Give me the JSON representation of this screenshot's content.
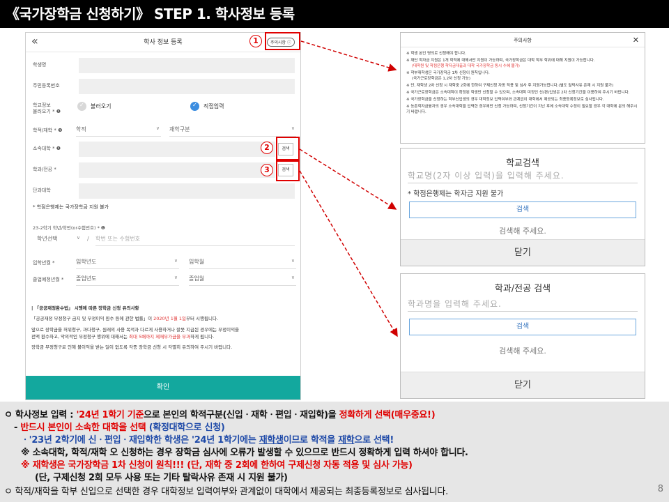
{
  "slide_title": "《국가장학금 신청하기》 STEP 1. 학사정보 등록",
  "form": {
    "back_icon": "«",
    "header_title": "학사 정보 등록",
    "notice_button": "주의사항 ⓘ",
    "student_name_label": "학생명",
    "resident_no_label": "주민등록번호",
    "school_info_label": "학교정보\n불러오기 * ❶",
    "radio_load": "불러오기",
    "radio_direct": "직접입력",
    "status_label": "학적/재학 * ❶",
    "status_select": "학적",
    "enroll_select": "재학구분",
    "university_label": "소속대학 * ❶",
    "major_label": "학과/전공 *",
    "college_label": "단과대학",
    "search_button": "검색",
    "no_credit_bank": "* 학점은행제는 국가장학금 지원 불가",
    "semester_label": "23-2학기 학년/학번(or수험번호) * ❶",
    "grade_select": "학년선택",
    "student_no_placeholder": "학번 또는 수험번호",
    "admission_label": "입학년월 *",
    "admission_year": "입학년도",
    "admission_month": "입학월",
    "graduation_label": "졸업예정년월 *",
    "graduation_year": "졸업년도",
    "graduation_month": "졸업월",
    "law_title": "| 「공공재정환수법」 시행에 따른 장학금 신청 유의사항",
    "law_line1a": "「공공재정 부정청구 금지 및 부정이익 환수 등에 관한 법률」이 ",
    "law_line1b": "2020년 1월 1일",
    "law_line1c": "부터 시행됩니다.",
    "law_line2": "앞으로 장학금을 허위청구, 과다청구, 원래의 사용 목적과 다르게 사용하거나 잘못 지급된 경우에는 부정이익을",
    "law_line3a": "전액 환수하고, 악의적인 부정청구 행위에 대해서는 ",
    "law_line3b": "최대 5배까지 제재부가금을 부과",
    "law_line3c": "하게 됩니다.",
    "law_line4": "장학금 부정청구로 인해 불이익을 받는 일이 없도록 각종 장학금 신청 시 각별히 유의하여 주시기 바랍니다.",
    "confirm_button": "확인"
  },
  "callouts": [
    "1",
    "2",
    "3"
  ],
  "notice_popup": {
    "title": "주의사항",
    "close": "✕",
    "items": [
      "※ 학생 본인 명의로 신청해야 합니다.",
      "※ 재단 학자금 지원은 1개 학적에 대해서만 지원이 가능하며, 국가장학금은 대학 학부 학위에 대해 지원이 가능합니다.",
      "(대학원 및 학점은행 학자금대출과 대학 국가장학금 동시 수혜 불가)",
      "※ 학부재학생은 국가장학금 1차 신청이 원칙입니다.",
      "(국가근로장학금은 1,2차 신청 가능)",
      "※ 단, 재학생 2차 신청 시 재학중 2회에 한하여 구제신청 자동 적용 및 심사 후 지원가능합니다.(별도 탈락사유 존재 시 지원 불가)",
      "※ 국가근로장학금은 소속대학이 확정된 학생만 신청할 수 있으며, 소속대학 미정인 신(편)입생은 2차 신청기간을 이용하여 주시기 바랍니다.",
      "※ 국가장학금을 신청하는 학부신입생의 경우 대학정보 입력여부와 관계없이 대학에서 제공되는 최종등록정보로 심사됩니다.",
      "※ 농촌학자금융자의 경우 소속대학을 입력한 경우에만 신청 가능하며, 신청기간이 지난 후에 소속대학 수정이 필요할 경우 각 대학에 문의 해주시기 바랍니다."
    ]
  },
  "school_popup": {
    "title": "학교검색",
    "placeholder": "학교명(2자 이상 입력)을 입력해 주세요.",
    "note": "* 학점은행제는 학자금 지원 불가",
    "search": "검색",
    "hint": "검색해 주세요.",
    "close": "닫기"
  },
  "major_popup": {
    "title": "학과/전공 검색",
    "placeholder": "학과명을 입력해 주세요.",
    "search": "검색",
    "hint": "검색해 주세요.",
    "close": "닫기"
  },
  "bottom": {
    "l1a": "ㅇ 학사정보 입력 : ",
    "l1b": "'24년 1학기 기준",
    "l1c": "으로 본인의 학적구분(신입ㆍ재학ㆍ편입ㆍ재입학)을 ",
    "l1d": "정확하게 선택(매우중요!)",
    "l2a": " - ",
    "l2b": "반드시 본인이 소속한 대학을 선택 ",
    "l2c": "(확정대학으로 신청)",
    "l3a": "  ㆍ'23년 2학기에 신ㆍ편입ㆍ재입학한 학생은 '24년 1학기에는 ",
    "l3b": "재학생",
    "l3c": "이므로 학적을 ",
    "l3d": "재학",
    "l3e": "으로 선택!",
    "l4": "  ※ 소속대학, 학적/재학 오 신청하는 경우 장학금 심사에 오류가 발생할 수 있으므로 반드시 정확하게 입력 하셔야 합니다.",
    "l5": "  ※ 재학생은 국가장학금 1차 신청이 원칙!!! (단, 재학 중 2회에 한하여 구제신청 자동 적용 및 심사 가능)",
    "l6": "     (단, 구제신청 2회 모두 사용 또는 기타 탈락사유 존재 시 지원 불가)",
    "l7": "ㅇ 학적/재학을 학부 신입으로 선택한 경우 대학정보 입력여부와 관계없이 대학에서 제공되는 최종등록정보로 심사됩니다.",
    "page": "8"
  }
}
